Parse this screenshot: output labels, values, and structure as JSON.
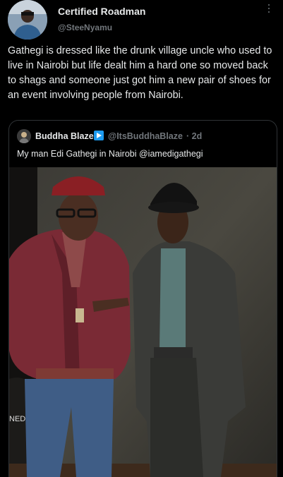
{
  "tweet": {
    "author_name": "Certified Roadman",
    "author_handle": "@SteeNyamu",
    "text": "Gathegi is dressed like the drunk village uncle who used to live in Nairobi but life dealt him a hard one so moved back to shags and someone just got him a new pair of shoes for an event involving people from Nairobi."
  },
  "quoted": {
    "author_name": "Buddha Blaze",
    "author_handle": "@ItsBuddhaBlaze",
    "time": "· 2d",
    "text": "My man Edi Gathegi in Nairobi @iamedigathegi",
    "photo_partial_text": "NED"
  },
  "colors": {
    "background": "#000000",
    "text": "#e7e9ea",
    "muted": "#71767b",
    "border": "#2f3336",
    "verified": "#1d9bf0"
  },
  "icons": {
    "more": "more-vertical-icon",
    "verified": "verified-badge-icon"
  }
}
